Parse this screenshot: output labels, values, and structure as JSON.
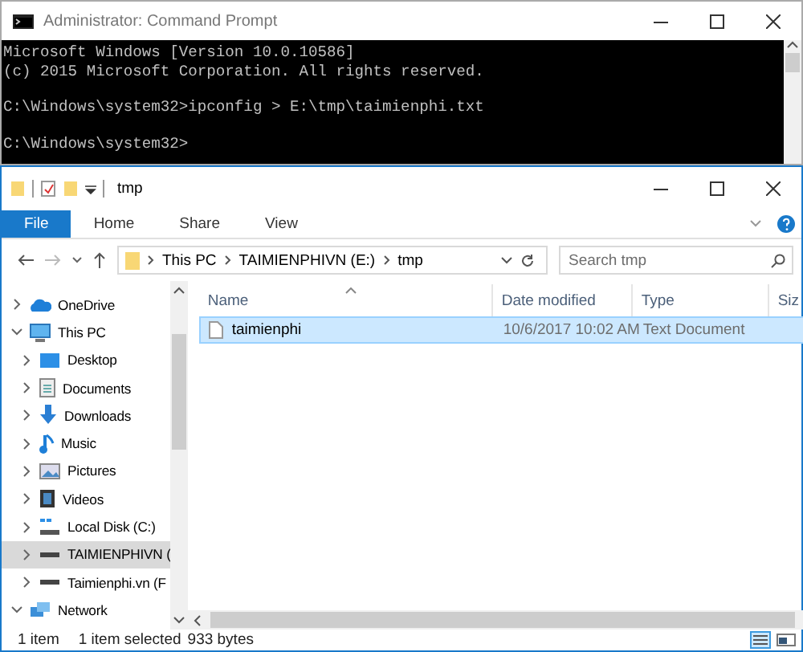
{
  "cmd": {
    "title": "Administrator: Command Prompt",
    "blocks": [
      [
        "Microsoft Windows [Version 10.0.10586]",
        "(c) 2015 Microsoft Corporation. All rights reserved."
      ],
      [
        "C:\\Windows\\system32>ipconfig > E:\\tmp\\taimienphi.txt"
      ],
      [
        "C:\\Windows\\system32>"
      ]
    ]
  },
  "explorer": {
    "title": "tmp",
    "ribbon_tabs": [
      {
        "label": "File",
        "selected": true
      },
      {
        "label": "Home",
        "selected": false
      },
      {
        "label": "Share",
        "selected": false
      },
      {
        "label": "View",
        "selected": false
      }
    ],
    "breadcrumb": [
      "This PC",
      "TAIMIENPHIVN (E:)",
      "tmp"
    ],
    "search": {
      "placeholder": "Search tmp"
    },
    "sidebar": [
      {
        "label": "OneDrive",
        "kind": "cloud",
        "expanded": false,
        "selected": false
      },
      {
        "label": "This PC",
        "kind": "pc",
        "expanded": true,
        "selected": false,
        "children": [
          {
            "label": "Desktop",
            "kind": "desktop",
            "expanded": false,
            "selected": false
          },
          {
            "label": "Documents",
            "kind": "documents",
            "expanded": false,
            "selected": false
          },
          {
            "label": "Downloads",
            "kind": "downloads",
            "expanded": false,
            "selected": false
          },
          {
            "label": "Music",
            "kind": "music",
            "expanded": false,
            "selected": false
          },
          {
            "label": "Pictures",
            "kind": "pictures",
            "expanded": false,
            "selected": false
          },
          {
            "label": "Videos",
            "kind": "videos",
            "expanded": false,
            "selected": false
          },
          {
            "label": "Local Disk (C:)",
            "kind": "disk",
            "expanded": false,
            "selected": false
          },
          {
            "label": "TAIMIENPHIVN (",
            "kind": "drive",
            "expanded": false,
            "selected": true
          },
          {
            "label": "Taimienphi.vn (F",
            "kind": "drive",
            "expanded": false,
            "selected": false
          }
        ]
      },
      {
        "label": "Network",
        "kind": "network",
        "expanded": true,
        "selected": false
      }
    ],
    "columns": [
      "Name",
      "Date modified",
      "Type",
      "Siz"
    ],
    "rows": [
      {
        "name": "taimienphi",
        "date": "10/6/2017 10:02 AM",
        "type": "Text Document",
        "selected": true
      }
    ],
    "status_bar": {
      "count": "1 item",
      "selection": "1 item selected",
      "size": "933 bytes"
    }
  }
}
